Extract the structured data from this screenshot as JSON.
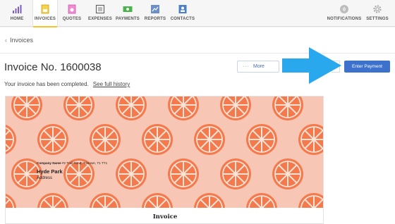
{
  "nav": {
    "items": [
      {
        "label": "HOME",
        "icon": "bar-chart-icon"
      },
      {
        "label": "INVOICES",
        "icon": "invoice-document-icon"
      },
      {
        "label": "QUOTES",
        "icon": "quote-document-icon"
      },
      {
        "label": "EXPENSES",
        "icon": "expense-frame-icon"
      },
      {
        "label": "PAYMENTS",
        "icon": "money-bill-icon"
      },
      {
        "label": "REPORTS",
        "icon": "report-chart-icon"
      },
      {
        "label": "CONTACTS",
        "icon": "contact-card-icon"
      }
    ],
    "notifications": {
      "label": "NOTIFICATIONS",
      "count": "0"
    },
    "settings": {
      "label": "SETTINGS"
    }
  },
  "breadcrumb": {
    "label": "Invoices"
  },
  "invoice": {
    "title": "Invoice No. 1600038",
    "status_text": "Your invoice has been completed.",
    "history_link": "See full history"
  },
  "actions": {
    "more_label": "More",
    "enter_payment_label": "Enter Payment"
  },
  "card": {
    "company_name": "Company Name",
    "company_address": "#2 Trail Road, Tristown, T1 TT1",
    "client_name": "Hyde Park",
    "client_address": "Address",
    "doc_label": "Invoice"
  },
  "colors": {
    "accent": "#3d72cc",
    "active_tab": "#f3c623",
    "arrow": "#2aa8ee",
    "banner": "#f8c6b4",
    "orange": "#f4794d"
  }
}
